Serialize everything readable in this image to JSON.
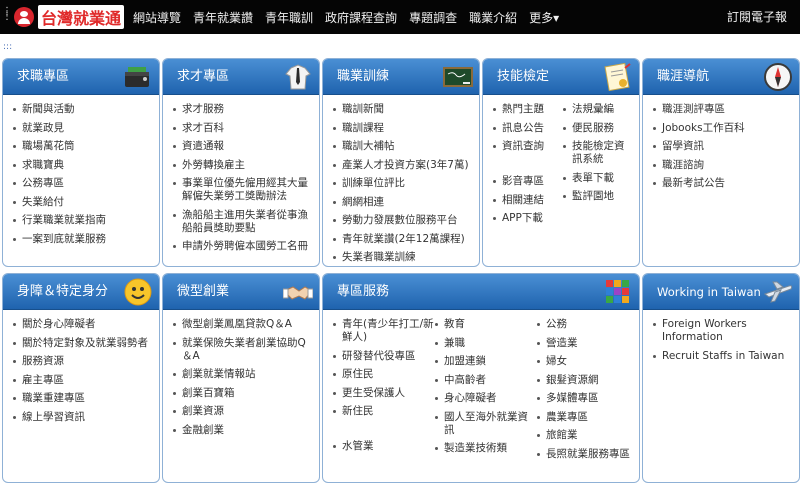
{
  "header": {
    "logo_text": "台灣就業通",
    "nav": [
      "網站導覽",
      "青年就業讚",
      "青年職訓",
      "政府課程查詢",
      "專題調查",
      "職業介紹",
      "更多▾"
    ],
    "subscribe": "訂閱電子報"
  },
  "panels": {
    "job_seek": {
      "title": "求職專區",
      "icon": "wallet-icon",
      "items": [
        "新聞與活動",
        "就業政見",
        "職場萬花筒",
        "求職寶典",
        "公務專區",
        "失業給付",
        "行業職業就業指南",
        "一案到底就業服務"
      ]
    },
    "recruit": {
      "title": "求才專區",
      "icon": "shirt-tie-icon",
      "items": [
        "求才服務",
        "求才百科",
        "資遣通報",
        "外勞轉換雇主",
        "事業單位優先僱用經其大量解僱失業勞工獎勵辦法",
        "漁船船主進用失業者從事漁船船員獎助要點",
        "申請外勞聘僱本國勞工名冊"
      ]
    },
    "training": {
      "title": "職業訓練",
      "icon": "blackboard-icon",
      "items": [
        "職訓新聞",
        "職訓課程",
        "職訓大補帖",
        "產業人才投資方案(3年7萬)",
        "訓練單位評比",
        "網網相連",
        "勞動力發展數位服務平台",
        "青年就業讚(2年12萬課程)",
        "失業者職業訓練"
      ]
    },
    "skill": {
      "title": "技能檢定",
      "icon": "certificate-icon",
      "col1": [
        "熱門主題",
        "訊息公告",
        "資訊查詢",
        "影音專區",
        "相關連結",
        "APP下載"
      ],
      "col2": [
        "法規彙編",
        "便民服務",
        "技能檢定資訊系統",
        "表單下載",
        "監評園地"
      ]
    },
    "career": {
      "title": "職涯導航",
      "icon": "compass-icon",
      "items": [
        "職涯測評專區",
        "Jobooks工作百科",
        "留學資訊",
        "職涯諮詢",
        "最新考試公告"
      ]
    },
    "disability": {
      "title": "身障＆特定身分",
      "icon": "smiley-icon",
      "items": [
        "關於身心障礙者",
        "關於特定對象及就業弱勢者",
        "服務資源",
        "雇主專區",
        "職業重建專區",
        "線上學習資訊"
      ]
    },
    "micro": {
      "title": "微型創業",
      "icon": "handshake-icon",
      "items": [
        "微型創業鳳凰貸款Q＆A",
        "就業保險失業者創業協助Q＆A",
        "創業就業情報站",
        "創業百寶箱",
        "創業資源",
        "金融創業"
      ]
    },
    "special": {
      "title": "專區服務",
      "icon": "colorful-blocks-icon",
      "col1": [
        "青年(青少年打工/新鮮人)",
        "研發替代役專區",
        "原住民",
        "更生受保護人",
        "新住民",
        "水管業"
      ],
      "col2": [
        "教育",
        "兼職",
        "加盟連鎖",
        "中高齡者",
        "身心障礙者",
        "國人至海外就業資訊",
        "製造業技術類"
      ],
      "col3": [
        "公務",
        "營造業",
        "婦女",
        "銀髮資源網",
        "多媒體專區",
        "農業專區",
        "旅館業",
        "長照就業服務專區"
      ]
    },
    "taiwan": {
      "title": "Working in Taiwan",
      "icon": "airplane-icon",
      "items": [
        "Foreign Workers Information",
        "Recruit Staffs in Taiwan"
      ]
    }
  },
  "colors": {
    "header_gradient_top": "#4a8fd4",
    "header_gradient_bottom": "#1f63ae",
    "panel_border": "#8fb1d6",
    "logo_red": "#d8262e"
  }
}
